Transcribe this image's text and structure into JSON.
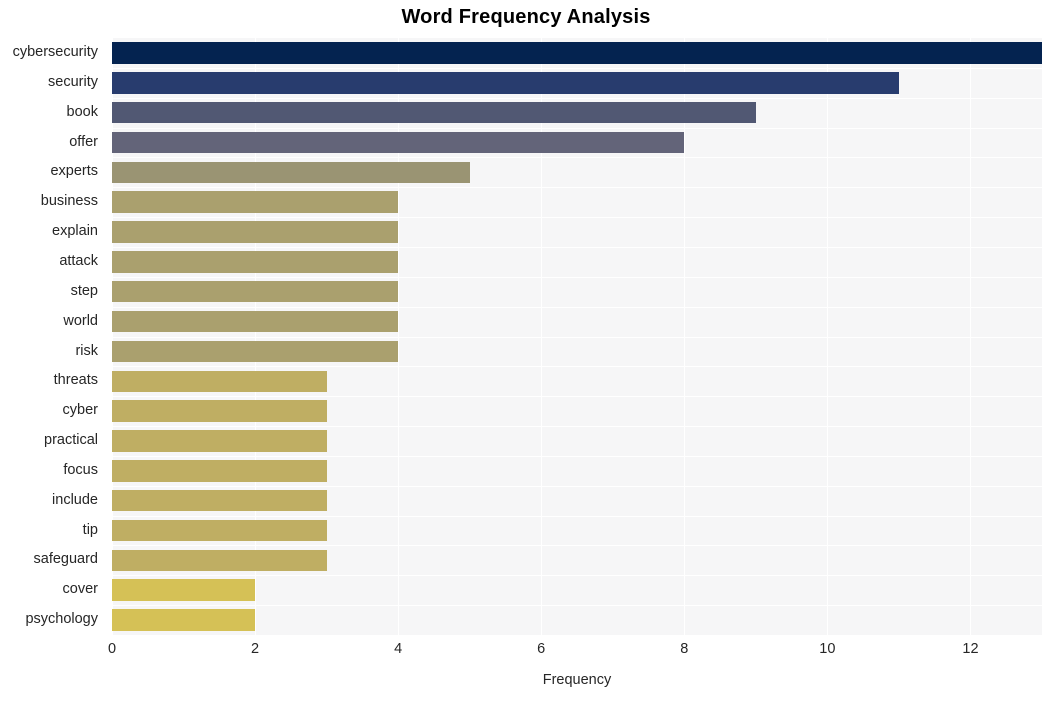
{
  "chart_data": {
    "type": "bar",
    "orientation": "horizontal",
    "title": "Word Frequency Analysis",
    "xlabel": "Frequency",
    "ylabel": "",
    "categories": [
      "cybersecurity",
      "security",
      "book",
      "offer",
      "experts",
      "business",
      "explain",
      "attack",
      "step",
      "world",
      "risk",
      "threats",
      "cyber",
      "practical",
      "focus",
      "include",
      "tip",
      "safeguard",
      "cover",
      "psychology"
    ],
    "values": [
      13,
      11,
      9,
      8,
      5,
      4,
      4,
      4,
      4,
      4,
      4,
      3,
      3,
      3,
      3,
      3,
      3,
      3,
      2,
      2
    ],
    "bar_colors": [
      "#042350",
      "#283c6e",
      "#515873",
      "#636479",
      "#9a9473",
      "#aaa06e",
      "#aaa06e",
      "#aaa06e",
      "#aaa06e",
      "#aaa06e",
      "#aaa06e",
      "#bfae63",
      "#bfae63",
      "#bfae63",
      "#bfae63",
      "#bfae63",
      "#bfae63",
      "#bfae63",
      "#d5c156",
      "#d5c156"
    ],
    "xticks": [
      0,
      2,
      4,
      6,
      8,
      10,
      12
    ],
    "xtick_labels": [
      "0",
      "2",
      "4",
      "6",
      "8",
      "10",
      "12"
    ],
    "xlim": [
      0,
      13.0
    ],
    "grid": true,
    "grid_color": "#ffffff",
    "plot_background": "#f6f6f7",
    "figure_background": "#ffffff",
    "title_color": "#000000",
    "tick_color": "#262626",
    "legend": null
  }
}
